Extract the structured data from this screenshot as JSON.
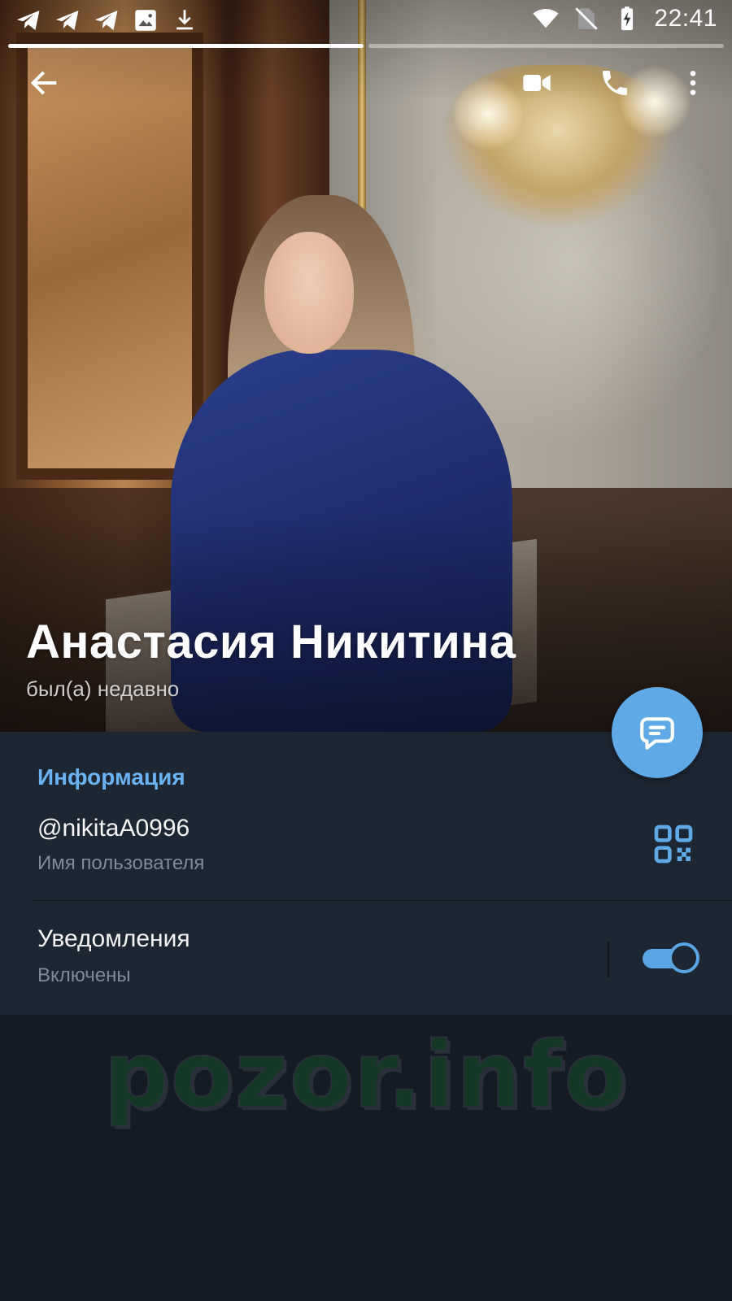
{
  "status_bar": {
    "time": "22:41",
    "left_icons": [
      "telegram-notification-icon",
      "telegram-notification-icon",
      "telegram-notification-icon",
      "image-icon",
      "download-icon"
    ],
    "right_icons": [
      "wifi-icon",
      "no-sim-icon",
      "battery-charging-icon"
    ]
  },
  "photo_pager": {
    "count": 2,
    "active_index": 0
  },
  "toolbar": {
    "back_icon": "arrow-left-icon",
    "video_icon": "video-camera-icon",
    "call_icon": "phone-icon",
    "more_icon": "more-vertical-icon"
  },
  "profile": {
    "name": "Анастасия Никитина",
    "status": "был(а) недавно"
  },
  "info": {
    "header": "Информация",
    "username": "@nikitaA0996",
    "username_caption": "Имя пользователя",
    "notifications_label": "Уведомления",
    "notifications_value": "Включены",
    "notifications_enabled": true
  },
  "fab": {
    "icon": "message-icon"
  },
  "watermark": {
    "text": "pozor.info"
  },
  "colors": {
    "accent": "#6ab2f2",
    "panel_bg": "#1d2633",
    "page_bg": "#141b24",
    "fab_bg": "#5ea9e6",
    "secondary_text": "#7f8b97",
    "watermark_fill": "#163826"
  }
}
